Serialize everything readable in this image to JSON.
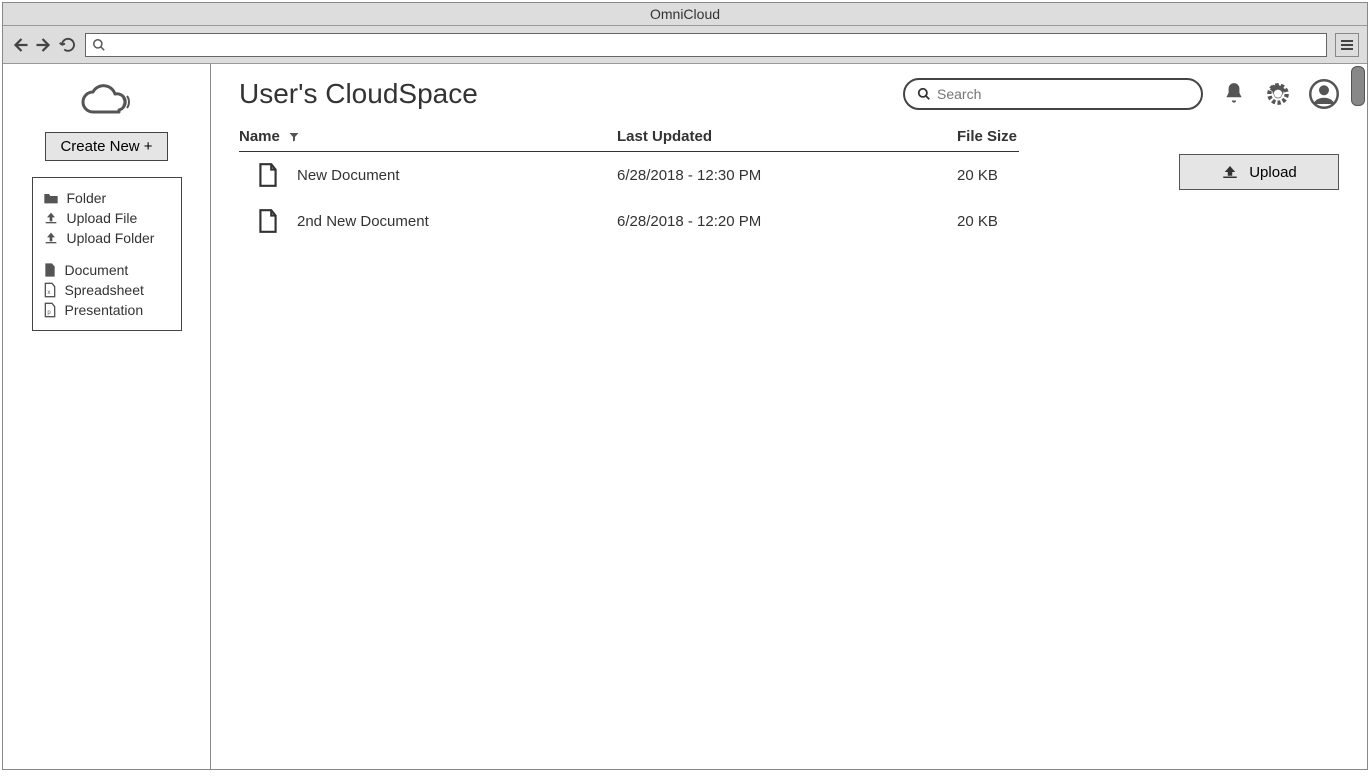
{
  "window": {
    "title": "OmniCloud"
  },
  "sidebar": {
    "create_label": "Create New +",
    "menu": {
      "folder": "Folder",
      "upload_file": "Upload File",
      "upload_folder": "Upload Folder",
      "document": "Document",
      "spreadsheet": "Spreadsheet",
      "presentation": "Presentation"
    }
  },
  "header": {
    "title": "User's CloudSpace",
    "search_placeholder": "Search"
  },
  "table": {
    "col_name": "Name",
    "col_date": "Last Updated",
    "col_size": "File Size",
    "rows": [
      {
        "name": "New Document",
        "date": "6/28/2018 - 12:30 PM",
        "size": "20 KB"
      },
      {
        "name": "2nd New Document",
        "date": "6/28/2018 - 12:20 PM",
        "size": "20 KB"
      }
    ]
  },
  "upload": {
    "label": "Upload"
  }
}
